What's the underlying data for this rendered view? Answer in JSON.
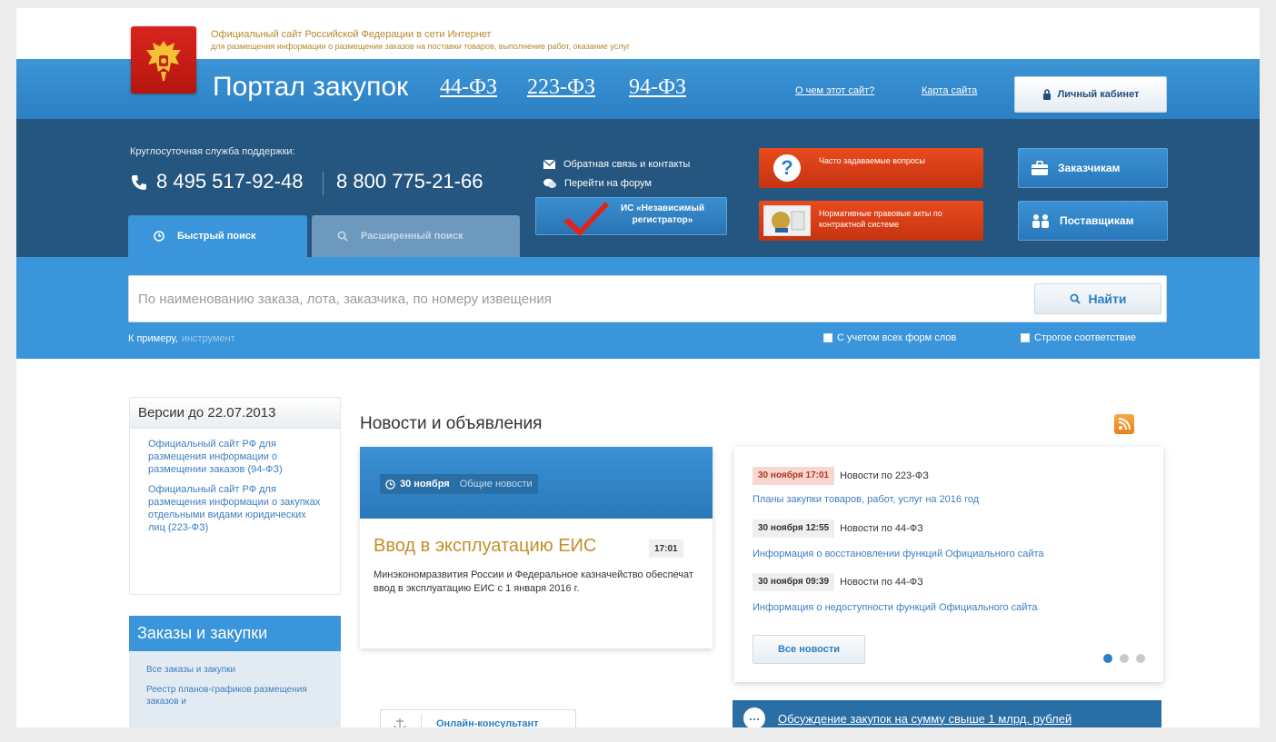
{
  "header": {
    "site_line1": "Официальный сайт Российской Федерации в сети Интернет",
    "site_line2": "для размещения информации о размещении заказов на поставки товаров, выполнение работ, оказание услуг",
    "portal_title": "Портал закупок",
    "law_links": [
      "44-ФЗ",
      "223-ФЗ",
      "94-ФЗ"
    ],
    "about_link": "О чем этот сайт?",
    "sitemap_link": "Карта сайта",
    "cabinet_button": "Личный кабинет"
  },
  "support": {
    "label": "Круглосуточная служба поддержки:",
    "phone1": "8 495 517-92-48",
    "phone2": "8 800 775-21-66"
  },
  "links": {
    "feedback": "Обратная связь и контакты",
    "forum": "Перейти на форум",
    "registrar": "ИС «Независимый регистратор»",
    "faq": "Часто задаваемые вопросы",
    "acts": "Нормативные правовые акты по контрактной системе",
    "customers": "Заказчикам",
    "suppliers": "Поставщикам"
  },
  "tabs": {
    "quick": "Быстрый поиск",
    "extended": "Расширенный поиск"
  },
  "search": {
    "placeholder": "По наименованию заказа, лота, заказчика, по номеру извещения",
    "button": "Найти",
    "example_label": "К примеру,",
    "example_value": "инструмент",
    "opt_all_forms": "С учетом всех форм слов",
    "opt_strict": "Строгое соответствие"
  },
  "versions": {
    "title": "Версии до 22.07.2013",
    "links": [
      "Официальный сайт РФ для размещения информации о размещении заказов (94-ФЗ)",
      "Официальный сайт РФ для размещения информации о закупках отдельными видами юридических лиц (223-ФЗ)"
    ]
  },
  "orders": {
    "title": "Заказы и закупки",
    "links": [
      "Все заказы и закупки",
      "Реестр планов-графиков размещения заказов и"
    ]
  },
  "news": {
    "section_title": "Новости и объявления",
    "featured": {
      "date": "30 ноября",
      "category": "Общие новости",
      "headline": "Ввод в эксплуатацию ЕИС",
      "time": "17:01",
      "body": "Минэкономразвития России и Федеральное казначейство обеспечат ввод в эксплуатацию ЕИС с 1 января 2016 г."
    },
    "feed": [
      {
        "date": "30 ноября 17:01",
        "category": "Новости по 223-ФЗ",
        "title": "Планы закупки товаров, работ, услуг на 2016 год"
      },
      {
        "date": "30 ноября 12:55",
        "category": "Новости по 44-ФЗ",
        "title": "Информация о восстановлении функций Официального сайта"
      },
      {
        "date": "30 ноября 09:39",
        "category": "Новости по 44-ФЗ",
        "title": "Информация о недоступности функций Официального сайта"
      }
    ],
    "all_news_button": "Все новости"
  },
  "footer": {
    "online_consultant": "Онлайн-консультант",
    "discussion": "Обсуждение закупок на сумму свыше 1 млрд. рублей"
  },
  "colors": {
    "brand_blue": "#3a95da",
    "dark_blue": "#25567f",
    "accent_red": "#d8371a",
    "headline_gold": "#c48d2b"
  }
}
